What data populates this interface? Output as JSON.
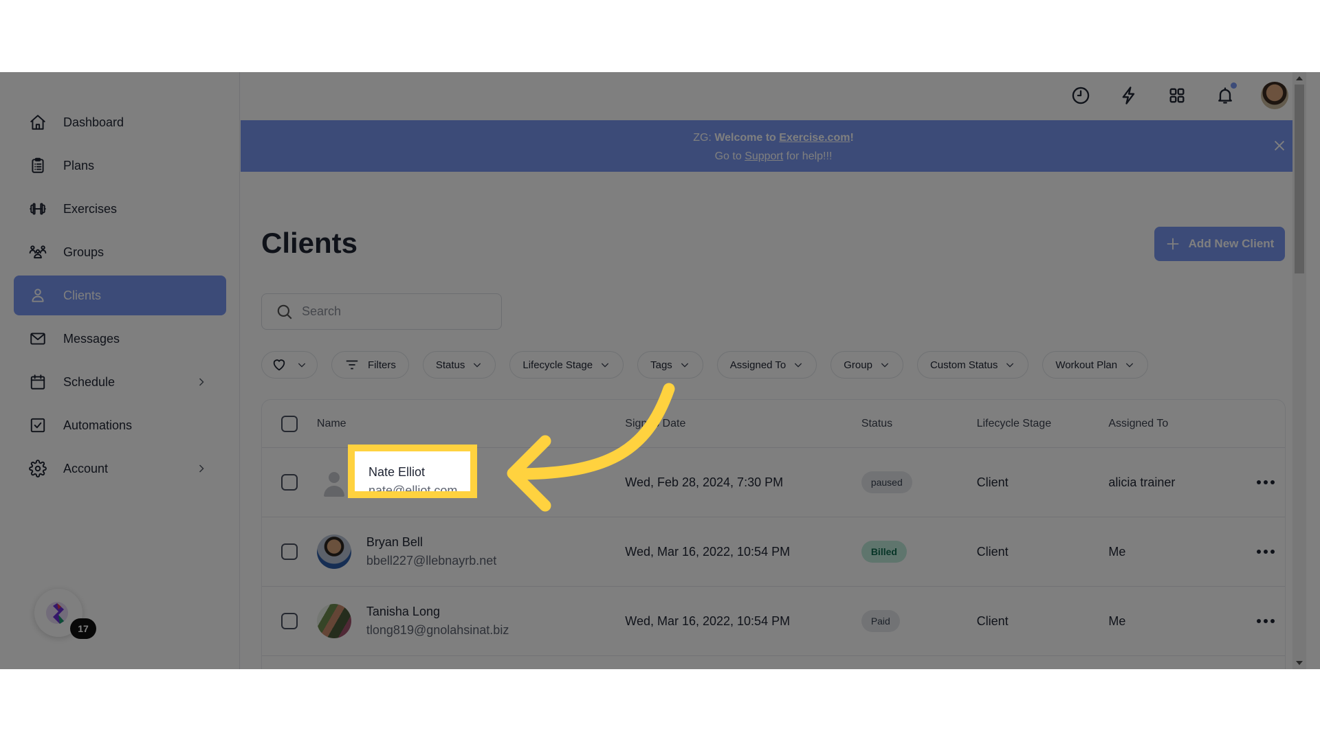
{
  "sidebar": {
    "items": [
      {
        "label": "Dashboard",
        "icon": "home-icon",
        "active": false
      },
      {
        "label": "Plans",
        "icon": "clipboard-icon",
        "active": false
      },
      {
        "label": "Exercises",
        "icon": "dumbbell-icon",
        "active": false
      },
      {
        "label": "Groups",
        "icon": "groups-icon",
        "active": false
      },
      {
        "label": "Clients",
        "icon": "user-icon",
        "active": true
      },
      {
        "label": "Messages",
        "icon": "mail-icon",
        "active": false
      },
      {
        "label": "Schedule",
        "icon": "calendar-icon",
        "active": false,
        "has_submenu": true
      },
      {
        "label": "Automations",
        "icon": "checkbox-icon",
        "active": false
      },
      {
        "label": "Account",
        "icon": "gear-icon",
        "active": false,
        "has_submenu": true
      }
    ],
    "widget_badge": "17"
  },
  "topbar": {
    "icons": [
      "clock-icon",
      "lightning-icon",
      "apps-grid-icon",
      "bell-icon",
      "avatar"
    ],
    "notification_dot": true
  },
  "banner": {
    "prefix": "ZG: ",
    "welcome_bold": "Welcome to ",
    "welcome_link": "Exercise.com",
    "welcome_end": "!",
    "line2_prefix": "Go to ",
    "line2_link": "Support",
    "line2_suffix": " for help!!!"
  },
  "page": {
    "title": "Clients",
    "add_button": "Add New Client",
    "search_placeholder": "Search"
  },
  "filters": [
    {
      "label": "",
      "icon": "heart-icon",
      "dropdown": true
    },
    {
      "label": "Filters",
      "icon": "filter-icon",
      "dropdown": false
    },
    {
      "label": "Status",
      "dropdown": true
    },
    {
      "label": "Lifecycle Stage",
      "dropdown": true
    },
    {
      "label": "Tags",
      "dropdown": true
    },
    {
      "label": "Assigned To",
      "dropdown": true
    },
    {
      "label": "Group",
      "dropdown": true
    },
    {
      "label": "Custom Status",
      "dropdown": true
    },
    {
      "label": "Workout Plan",
      "dropdown": true
    }
  ],
  "table": {
    "columns": [
      "Name",
      "Signup Date",
      "Status",
      "Lifecycle Stage",
      "Assigned To"
    ],
    "rows": [
      {
        "name": "Nate Elliot",
        "email": "nate@elliot.com",
        "signup": "Wed, Feb 28, 2024, 7:30 PM",
        "status": "paused",
        "status_color": "#e5e7eb",
        "status_text_color": "#374151",
        "stage": "Client",
        "assigned": "alicia trainer"
      },
      {
        "name": "Bryan Bell",
        "email": "bbell227@llebnayrb.net",
        "signup": "Wed, Mar 16, 2022, 10:54 PM",
        "status": "Billed",
        "status_color": "#bfeadb",
        "status_text_color": "#0f6b4f",
        "stage": "Client",
        "assigned": "Me"
      },
      {
        "name": "Tanisha Long",
        "email": "tlong819@gnolahsinat.biz",
        "signup": "Wed, Mar 16, 2022, 10:54 PM",
        "status": "Paid",
        "status_color": "#e5e7eb",
        "status_text_color": "#374151",
        "stage": "Client",
        "assigned": "Me"
      }
    ]
  },
  "annotation": {
    "highlight_name": "Nate Elliot",
    "highlight_email": "nate@elliot.com",
    "highlight_color": "#ffd23f"
  },
  "colors": {
    "accent": "#7896f0",
    "overlay": "rgba(0,0,0,0.5)"
  }
}
